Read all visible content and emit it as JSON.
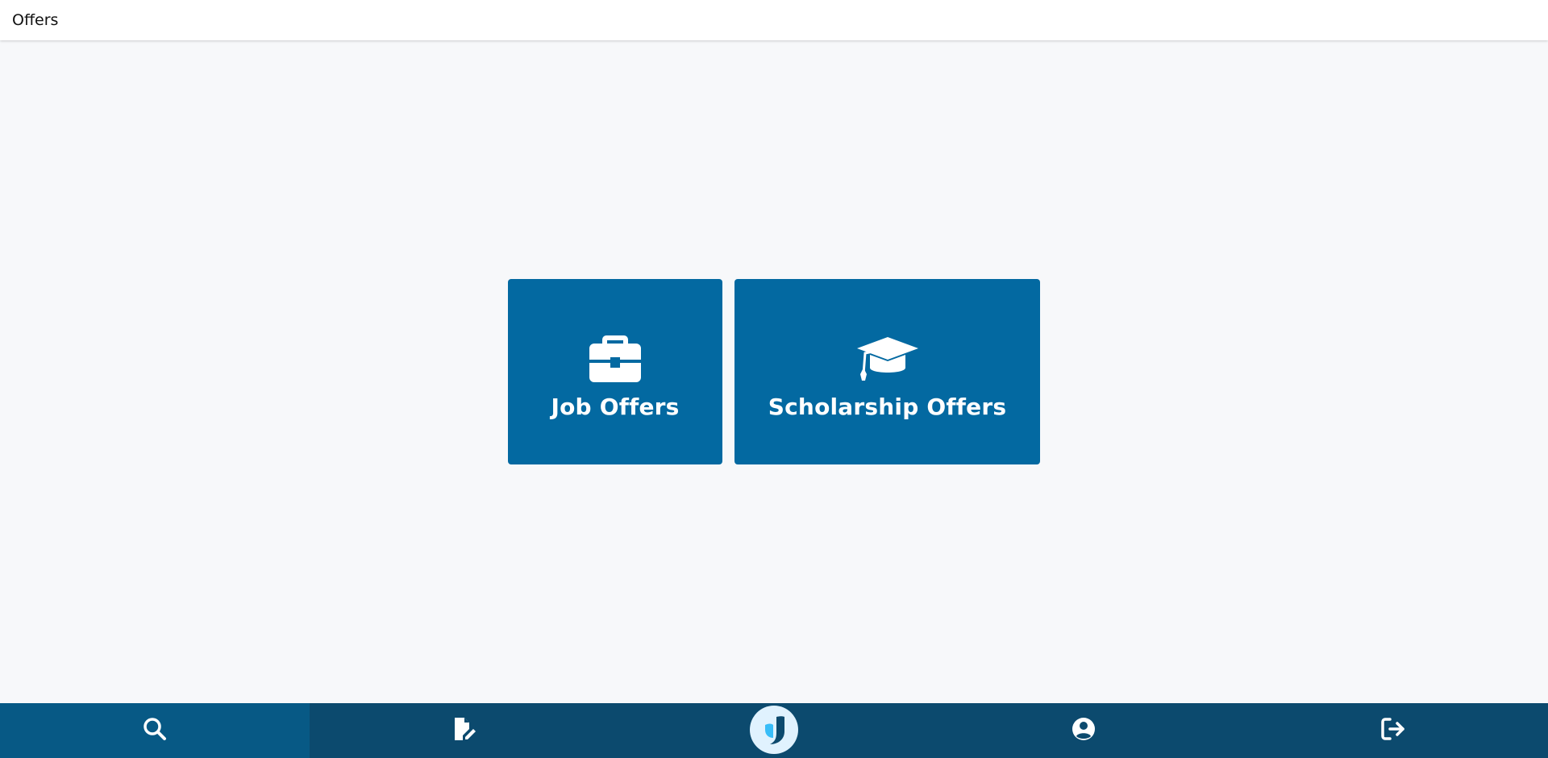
{
  "header": {
    "title": "Offers"
  },
  "tiles": [
    {
      "label": "Job Offers",
      "icon": "briefcase-icon"
    },
    {
      "label": "Scholarship Offers",
      "icon": "graduation-cap-icon"
    }
  ],
  "bottom_nav": {
    "items": [
      {
        "icon": "search-icon",
        "active": true
      },
      {
        "icon": "file-edit-icon",
        "active": false
      },
      {
        "icon": "app-logo-icon",
        "active": false
      },
      {
        "icon": "user-circle-icon",
        "active": false
      },
      {
        "icon": "logout-icon",
        "active": false
      }
    ]
  },
  "colors": {
    "tile_bg": "#0369a1",
    "nav_bg": "#0c4a6e",
    "nav_active_bg": "#075985",
    "page_bg": "#f7f8fa"
  }
}
